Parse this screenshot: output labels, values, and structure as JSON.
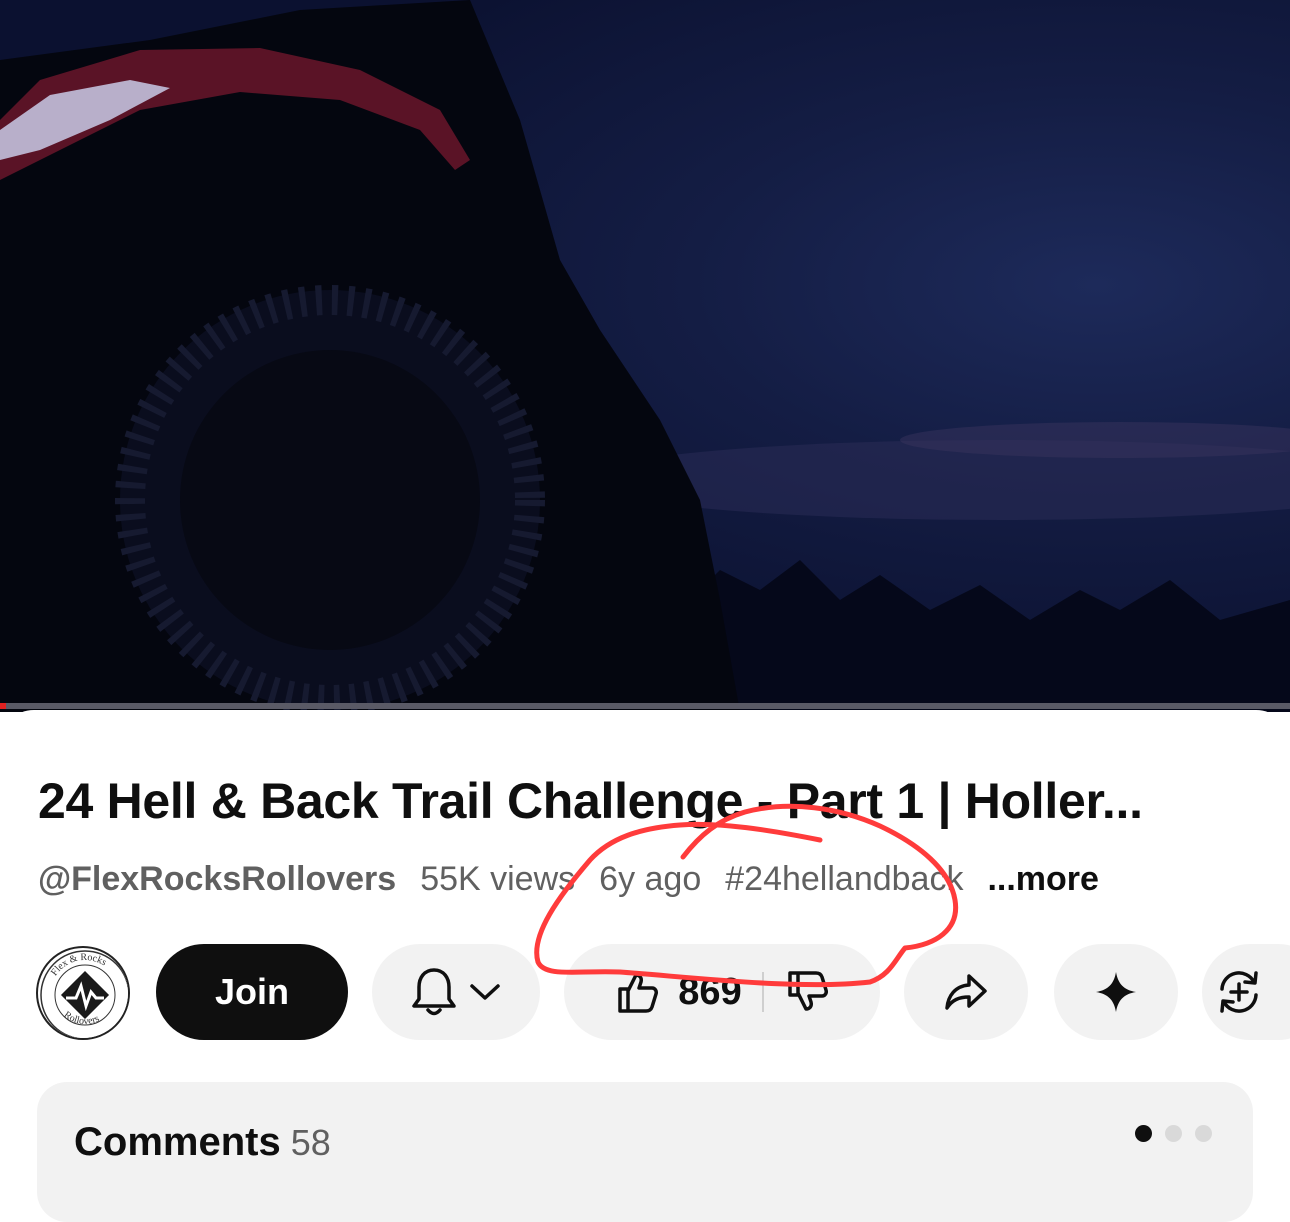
{
  "video": {
    "progress_fraction": 0.005
  },
  "title": "24 Hell & Back Trail Challenge - Part 1 | Holler...",
  "meta": {
    "channel": "@FlexRocksRollovers",
    "views": "55K views",
    "age": "6y ago",
    "hashtag": "#24hellandback",
    "more": "...more"
  },
  "channel_logo": {
    "text_top": "Flex & Rocks",
    "text_bottom": "Rollovers"
  },
  "actions": {
    "join_label": "Join",
    "like_count": "869"
  },
  "icons": {
    "bell": "bell-icon",
    "chevron": "chevron-down-icon",
    "like": "thumbs-up-icon",
    "dislike": "thumbs-down-icon",
    "share": "share-icon",
    "ask": "sparkle-icon",
    "remix": "remix-icon"
  },
  "comments": {
    "label": "Comments",
    "count": "58"
  },
  "colors": {
    "progress": "#e02121",
    "annotation": "#ff3b3b",
    "join_bg": "#0f0f0f",
    "pill_bg": "#f2f2f2"
  }
}
